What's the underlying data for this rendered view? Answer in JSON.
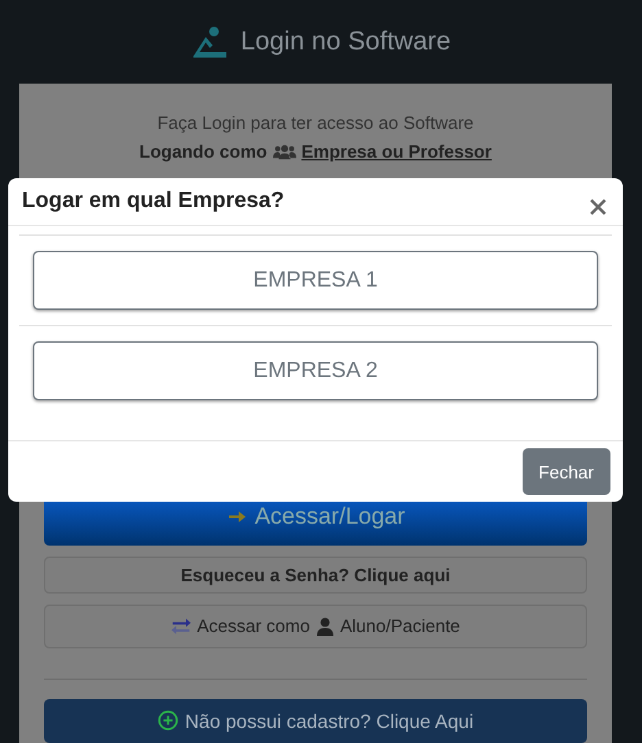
{
  "header": {
    "title": "Login no Software"
  },
  "card": {
    "intro": "Faça Login para ter acesso ao Software",
    "role_prefix": "Logando como",
    "role_link": "Empresa ou Professor",
    "login_button": "Acessar/Logar",
    "forgot_button": "Esqueceu a Senha? Clique aqui",
    "switch_prefix": "Acessar como",
    "switch_role": "Aluno/Paciente",
    "signup_button": "Não possui cadastro? Clique Aqui"
  },
  "modal": {
    "title": "Logar em qual Empresa?",
    "options": [
      "EMPRESA 1",
      "EMPRESA 2"
    ],
    "close_button": "Fechar"
  }
}
